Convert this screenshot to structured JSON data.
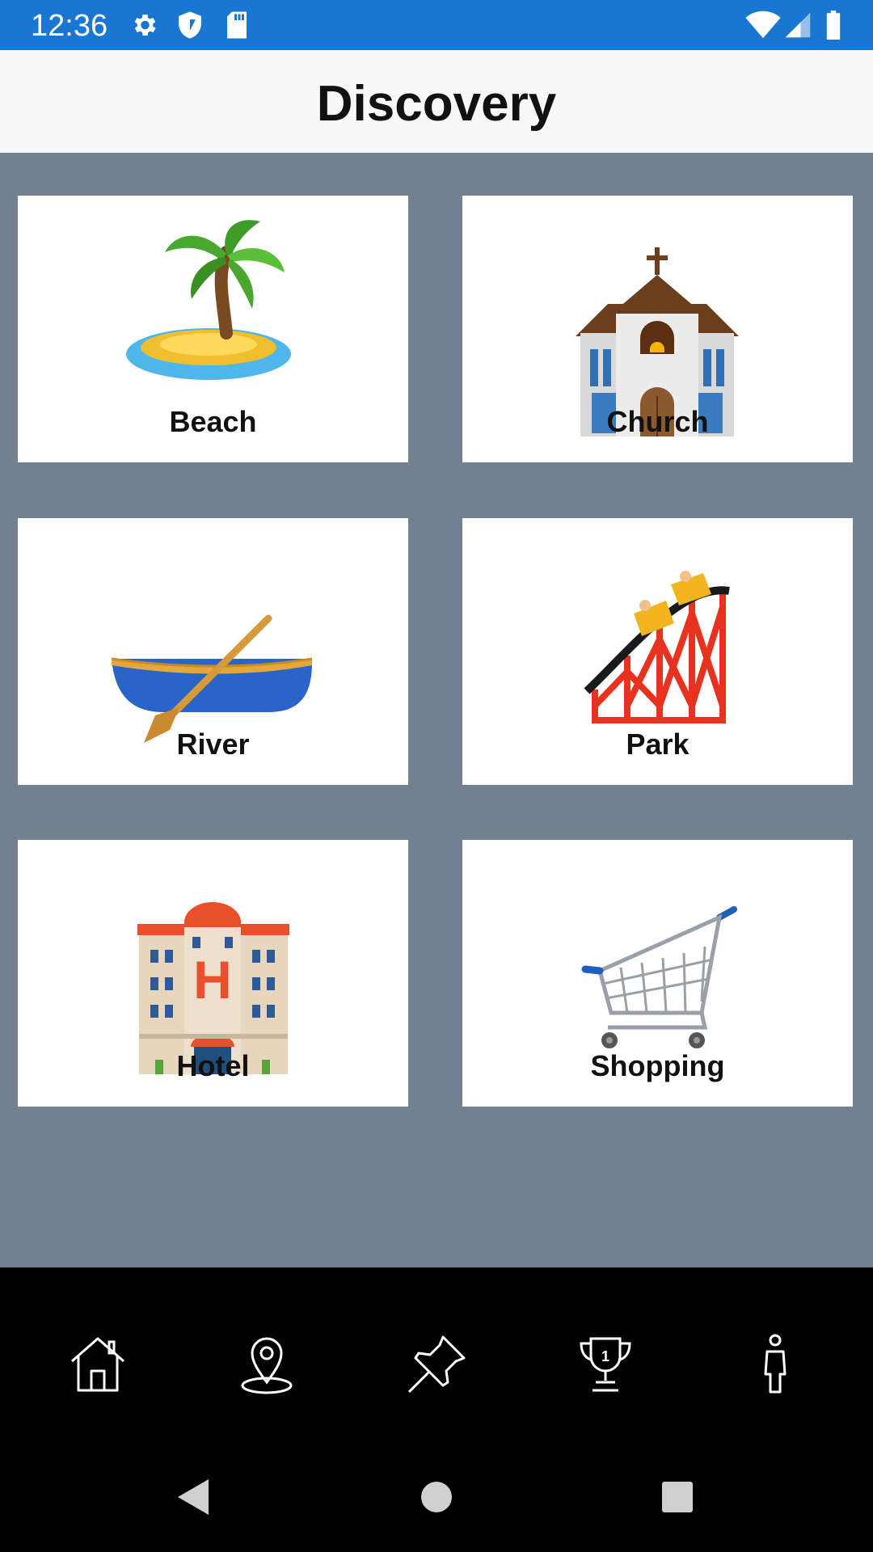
{
  "status_bar": {
    "time": "12:36",
    "icons_left": [
      "gear-icon",
      "shield-icon",
      "sd-card-icon"
    ],
    "icons_right": [
      "wifi-icon",
      "signal-icon",
      "battery-icon"
    ],
    "color": "#1976d2"
  },
  "header": {
    "title": "Discovery"
  },
  "categories": [
    {
      "label": "Beach",
      "icon": "desert-island-icon"
    },
    {
      "label": "Church",
      "icon": "church-icon"
    },
    {
      "label": "River",
      "icon": "canoe-icon"
    },
    {
      "label": "Park",
      "icon": "roller-coaster-icon"
    },
    {
      "label": "Hotel",
      "icon": "hotel-icon"
    },
    {
      "label": "Shopping",
      "icon": "shopping-cart-icon"
    }
  ],
  "bottom_nav": {
    "items": [
      {
        "icon": "home-icon"
      },
      {
        "icon": "map-pin-icon"
      },
      {
        "icon": "push-pin-icon"
      },
      {
        "icon": "trophy-icon"
      },
      {
        "icon": "person-icon"
      }
    ]
  },
  "system_nav": {
    "buttons": [
      "back-icon",
      "home-circle-icon",
      "recents-icon"
    ]
  },
  "colors": {
    "background": "#72808f",
    "card": "#ffffff",
    "nav": "#000000"
  }
}
